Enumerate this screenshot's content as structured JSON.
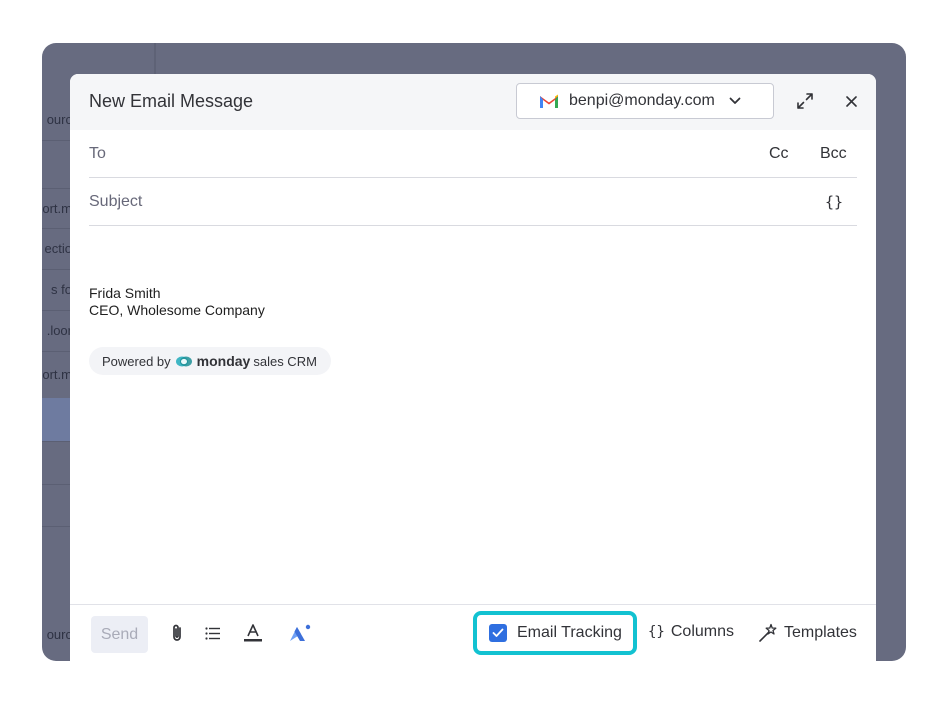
{
  "background": {
    "row_fragments": [
      "ourc",
      "ort.m",
      "ectio",
      "s fo",
      ".loor",
      "ort.m",
      "",
      "",
      "",
      "ourc"
    ]
  },
  "header": {
    "title": "New Email Message",
    "account": "benpi@monday.com",
    "icons": [
      "gmail-icon",
      "chevron-down-icon",
      "expand-icon",
      "close-icon"
    ]
  },
  "fields": {
    "to_label": "To",
    "cc_label": "Cc",
    "bcc_label": "Bcc",
    "subject_label": "Subject",
    "variables_label": "{}"
  },
  "body": {
    "signature_name": "Frida Smith",
    "signature_title": "CEO, Wholesome Company",
    "powered_prefix": "Powered by",
    "powered_brand": "monday",
    "powered_suffix": "sales CRM"
  },
  "toolbar": {
    "send_label": "Send",
    "icons": [
      "attachment-icon",
      "list-icon",
      "text-color-icon",
      "ai-assistant-icon",
      "columns-braces-icon",
      "templates-wand-icon"
    ],
    "email_tracking_label": "Email Tracking",
    "email_tracking_checked": true,
    "columns_braces": "{}",
    "columns_label": "Columns",
    "templates_label": "Templates"
  },
  "colors": {
    "accent": "#12c2d1",
    "checkbox": "#2f6fe0",
    "overlay": "#676b80"
  }
}
